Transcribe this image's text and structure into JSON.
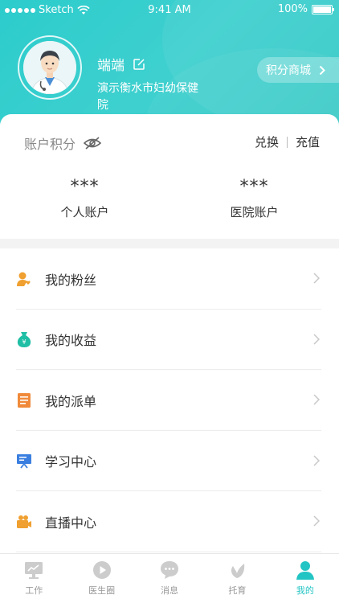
{
  "status_bar": {
    "carrier": "Sketch",
    "time": "9:41 AM",
    "battery": "100%"
  },
  "profile": {
    "name": "端端",
    "hospital": "演示衡水市妇幼保健院"
  },
  "points_mall_label": "积分商城",
  "account": {
    "title": "账户积分",
    "exchange_label": "兑换",
    "recharge_label": "充值",
    "personal": {
      "value": "***",
      "label": "个人账户"
    },
    "hospital": {
      "value": "***",
      "label": "医院账户"
    }
  },
  "menu": [
    {
      "label": "我的粉丝",
      "icon": "fans-icon",
      "color": "#f0a030"
    },
    {
      "label": "我的收益",
      "icon": "money-bag-icon",
      "color": "#1fbfa5"
    },
    {
      "label": "我的派单",
      "icon": "document-icon",
      "color": "#f08a3a"
    },
    {
      "label": "学习中心",
      "icon": "presentation-icon",
      "color": "#3a7fe0"
    },
    {
      "label": "直播中心",
      "icon": "video-camera-icon",
      "color": "#f0a030"
    }
  ],
  "tabs": [
    {
      "label": "工作",
      "icon": "dashboard-icon",
      "active": false
    },
    {
      "label": "医生圈",
      "icon": "play-circle-icon",
      "active": false
    },
    {
      "label": "消息",
      "icon": "chat-bubble-icon",
      "active": false
    },
    {
      "label": "托育",
      "icon": "leaf-icon",
      "active": false
    },
    {
      "label": "我的",
      "icon": "person-icon",
      "active": true
    }
  ],
  "colors": {
    "primary": "#2ccaca",
    "active_tab": "#23c4c4",
    "inactive_tab": "#cccccc"
  }
}
